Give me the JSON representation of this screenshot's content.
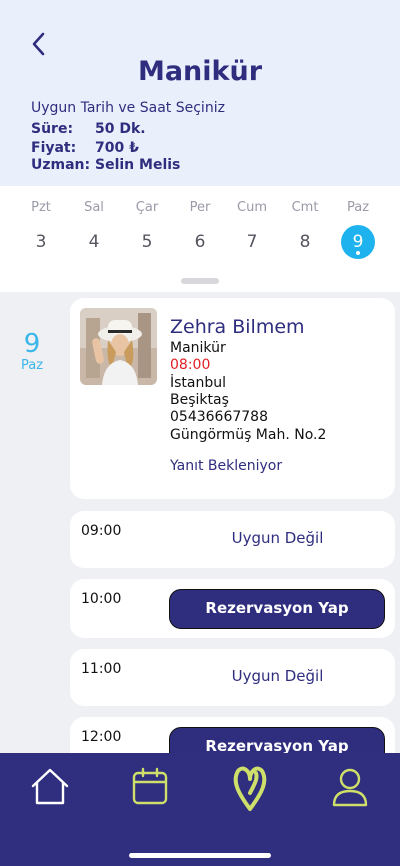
{
  "header": {
    "title": "Manikür",
    "subtitle": "Uygun Tarih ve Saat Seçiniz",
    "duration_label": "Süre:",
    "duration_value": "50 Dk.",
    "price_label": "Fiyat:",
    "price_value": "700 ₺",
    "expert_label": "Uzman:",
    "expert_value": "Selin Melis"
  },
  "days": [
    {
      "name": "Pzt",
      "num": "3"
    },
    {
      "name": "Sal",
      "num": "4"
    },
    {
      "name": "Çar",
      "num": "5"
    },
    {
      "name": "Per",
      "num": "6"
    },
    {
      "name": "Cum",
      "num": "7"
    },
    {
      "name": "Cmt",
      "num": "8"
    },
    {
      "name": "Paz",
      "num": "9"
    }
  ],
  "selected_day": {
    "num": "9",
    "name": "Paz"
  },
  "appointment": {
    "name": "Zehra Bilmem",
    "service": "Manikür",
    "time": "08:00",
    "city": "İstanbul",
    "district": "Beşiktaş",
    "phone": "05436667788",
    "address": "Güngörmüş Mah. No.2",
    "status": "Yanıt Bekleniyor"
  },
  "slots": [
    {
      "time": "09:00",
      "label": "Uygun Değil"
    },
    {
      "time": "10:00",
      "label": "Rezervasyon Yap"
    },
    {
      "time": "11:00",
      "label": "Uygun Değil"
    },
    {
      "time": "12:00",
      "label": "Rezervasyon Yap"
    }
  ],
  "colors": {
    "primary": "#302e7e",
    "accent": "#1eb2ef",
    "tab_icon": "#cfe06a",
    "time_red": "#e01e24"
  },
  "tabs": [
    "home-icon",
    "calendar-icon",
    "heart-icon",
    "profile-icon"
  ]
}
